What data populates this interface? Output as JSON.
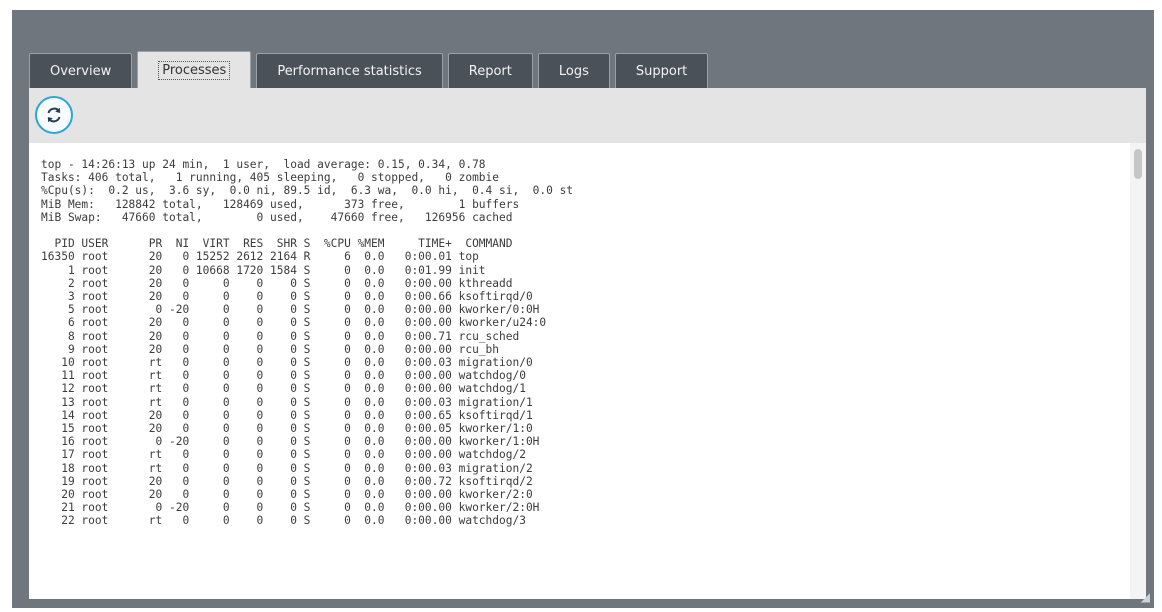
{
  "tabs": [
    {
      "label": "Overview",
      "active": false
    },
    {
      "label": "Processes",
      "active": true
    },
    {
      "label": "Performance statistics",
      "active": false
    },
    {
      "label": "Report",
      "active": false
    },
    {
      "label": "Logs",
      "active": false
    },
    {
      "label": "Support",
      "active": false
    }
  ],
  "toolbar": {
    "refresh_icon": "refresh-icon"
  },
  "console": {
    "summary": [
      "top - 14:26:13 up 24 min,  1 user,  load average: 0.15, 0.34, 0.78",
      "Tasks: 406 total,   1 running, 405 sleeping,   0 stopped,   0 zombie",
      "%Cpu(s):  0.2 us,  3.6 sy,  0.0 ni, 89.5 id,  6.3 wa,  0.0 hi,  0.4 si,  0.0 st",
      "MiB Mem:   128842 total,   128469 used,      373 free,        1 buffers",
      "MiB Swap:   47660 total,        0 used,    47660 free,   126956 cached"
    ],
    "header": "  PID USER      PR  NI  VIRT  RES  SHR S  %CPU %MEM     TIME+  COMMAND",
    "rows": [
      "16350 root      20   0 15252 2612 2164 R     6  0.0   0:00.01 top",
      "    1 root      20   0 10668 1720 1584 S     0  0.0   0:01.99 init",
      "    2 root      20   0     0    0    0 S     0  0.0   0:00.00 kthreadd",
      "    3 root      20   0     0    0    0 S     0  0.0   0:00.66 ksoftirqd/0",
      "    5 root       0 -20     0    0    0 S     0  0.0   0:00.00 kworker/0:0H",
      "    6 root      20   0     0    0    0 S     0  0.0   0:00.00 kworker/u24:0",
      "    8 root      20   0     0    0    0 S     0  0.0   0:00.71 rcu_sched",
      "    9 root      20   0     0    0    0 S     0  0.0   0:00.00 rcu_bh",
      "   10 root      rt   0     0    0    0 S     0  0.0   0:00.03 migration/0",
      "   11 root      rt   0     0    0    0 S     0  0.0   0:00.00 watchdog/0",
      "   12 root      rt   0     0    0    0 S     0  0.0   0:00.00 watchdog/1",
      "   13 root      rt   0     0    0    0 S     0  0.0   0:00.03 migration/1",
      "   14 root      20   0     0    0    0 S     0  0.0   0:00.65 ksoftirqd/1",
      "   15 root      20   0     0    0    0 S     0  0.0   0:00.05 kworker/1:0",
      "   16 root       0 -20     0    0    0 S     0  0.0   0:00.00 kworker/1:0H",
      "   17 root      rt   0     0    0    0 S     0  0.0   0:00.00 watchdog/2",
      "   18 root      rt   0     0    0    0 S     0  0.0   0:00.03 migration/2",
      "   19 root      20   0     0    0    0 S     0  0.0   0:00.72 ksoftirqd/2",
      "   20 root      20   0     0    0    0 S     0  0.0   0:00.00 kworker/2:0",
      "   21 root       0 -20     0    0    0 S     0  0.0   0:00.00 kworker/2:0H",
      "   22 root      rt   0     0    0    0 S     0  0.0   0:00.00 watchdog/3"
    ]
  }
}
